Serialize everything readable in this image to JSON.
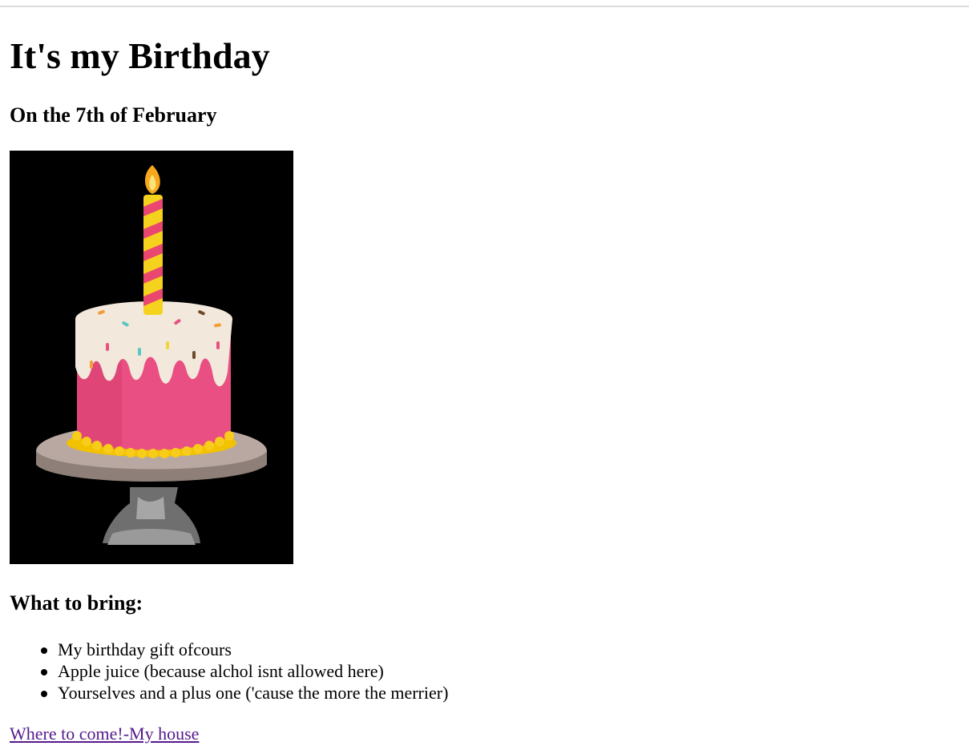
{
  "page": {
    "title": "It's my Birthday",
    "subtitle": "On the 7th of February"
  },
  "photo": {
    "description": "birthday-cake-photo"
  },
  "bring": {
    "heading": "What to bring:",
    "items": [
      "My birthday gift ofcours",
      "Apple juice (because alchol isnt allowed here)",
      "Yourselves and a plus one ('cause the more the merrier)"
    ]
  },
  "link": {
    "label": "Where to come!-My house",
    "color": "#551a8b"
  }
}
